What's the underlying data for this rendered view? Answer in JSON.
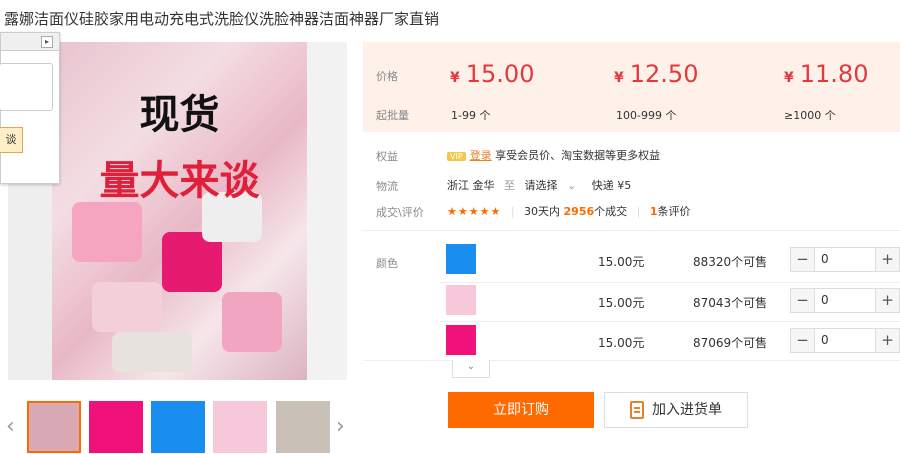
{
  "product": {
    "title": "露娜洁面仪硅胶家用电动充电式洗脸仪洗脸神器洁面神器厂家直销"
  },
  "main_image": {
    "line1": "现货",
    "line2": "量大来谈"
  },
  "popup": {
    "button_label": "谈"
  },
  "thumbnails": [
    {
      "label": "thumb-1",
      "color": "#d9a9b5"
    },
    {
      "label": "thumb-2",
      "color": "#f0117a"
    },
    {
      "label": "thumb-3",
      "color": "#1a8ef0"
    },
    {
      "label": "thumb-4",
      "color": "#f7c8d9"
    },
    {
      "label": "thumb-5",
      "color": "#c9c0b8"
    }
  ],
  "pricing": {
    "price_label": "价格",
    "qty_label": "起批量",
    "currency": "¥",
    "tiers": [
      {
        "price": "15.00",
        "range": "1-99 个"
      },
      {
        "price": "12.50",
        "range": "100-999 个"
      },
      {
        "price": "11.80",
        "range": "≥1000 个"
      }
    ]
  },
  "benefits": {
    "label": "权益",
    "badge": "VIP",
    "login": "登录",
    "text": "享受会员价、淘宝数据等更多权益"
  },
  "logistics": {
    "label": "物流",
    "origin": "浙江 金华",
    "to": "至",
    "dest": "请选择",
    "express": "快递 ¥5"
  },
  "trades": {
    "label": "成交\\评价",
    "stars": "★★★★★",
    "prefix": "30天内",
    "count": "2956",
    "suffix": "个成交",
    "reviews_count": "1",
    "reviews_suffix": "条评价"
  },
  "colors": {
    "label": "颜色",
    "items": [
      {
        "hex": "#1a8ef0",
        "price": "15.00元",
        "stock": "88320个可售",
        "qty": "0"
      },
      {
        "hex": "#f7c8d9",
        "price": "15.00元",
        "stock": "87043个可售",
        "qty": "0"
      },
      {
        "hex": "#f0117a",
        "price": "15.00元",
        "stock": "87069个可售",
        "qty": "0"
      }
    ]
  },
  "actions": {
    "order": "立即订购",
    "cart": "加入进货单"
  },
  "accent": "#ff6a00"
}
